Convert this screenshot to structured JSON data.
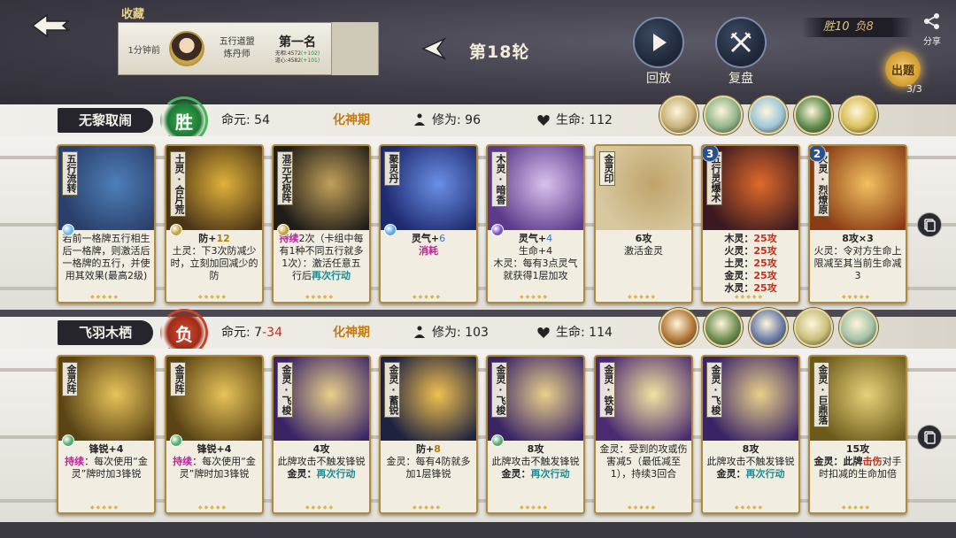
{
  "header": {
    "favorites_label": "收藏",
    "fav_card": {
      "time": "1分钟前",
      "title_line1": "五行道盟",
      "title_line2": "炼丹师",
      "rank": "第一名",
      "stat1_label": "无相:",
      "stat1_value": "4572",
      "stat1_delta": "(+102)",
      "stat2_label": "道心:",
      "stat2_value": "4582",
      "stat2_delta": "(+101)",
      "ladder_label": "天梯"
    },
    "round_label": "第18轮",
    "replay_label": "回放",
    "review_label": "复盘",
    "score_win": "胜10",
    "score_lose": "负8",
    "share_label": "分享",
    "quest_label": "出题",
    "quest_count": "3/3"
  },
  "player1": {
    "name": "无黎取闹",
    "result": "胜",
    "life_label": "命元:",
    "life_value": "54",
    "realm": "化神期",
    "cultivation_label": "修为:",
    "cultivation_value": "96",
    "hp_label": "生命:",
    "hp_value": "112",
    "avatar_colors": [
      "#c9b27a",
      "#8fb58a",
      "#9cc7d9",
      "#5f8d4e",
      "#d8c15a"
    ],
    "cards": [
      {
        "title": "五行流转",
        "orb": "#6cb8e8",
        "lines": [
          {
            "t": "若前一格牌五行相生后一格牌，则激活后一格牌的五行，并使用其效果(最高2级)"
          }
        ],
        "colors": [
          "#2a3f6b",
          "#4e7fb8"
        ]
      },
      {
        "title": "土灵·合片荒",
        "orb": "#c9a23a",
        "lines": [
          {
            "t": "防+",
            "c": "b"
          },
          {
            "t": "12",
            "c": "hl-gold",
            "inline": true
          },
          {
            "t": "土灵：下3次防减少时，立刻加回减少的防"
          }
        ],
        "colors": [
          "#4a3416",
          "#e0b23a"
        ]
      },
      {
        "title": "混元无极阵",
        "orb": "#c9a23a",
        "lines": [
          {
            "t": "持续",
            "c": "hl-magenta"
          },
          {
            "t": "2次（卡组中每有1种不同五行就多1次）：激活任意五行后",
            "inline": true
          },
          {
            "t": "再次行动",
            "c": "hl-teal",
            "inline": true
          }
        ],
        "colors": [
          "#201c18",
          "#c2a15a"
        ]
      },
      {
        "title": "聚灵丹",
        "orb": "#5da8e6",
        "lines": [
          {
            "t": "灵气+",
            "c": "b"
          },
          {
            "t": "6",
            "c": "hl-blue",
            "inline": true
          },
          {
            "t": "消耗",
            "c": "hl-magenta"
          }
        ],
        "colors": [
          "#1e2a6e",
          "#6b8fe6"
        ]
      },
      {
        "title": "木灵·暗香",
        "orb": "#7a4fd0",
        "lines": [
          {
            "t": "灵气+",
            "c": "b"
          },
          {
            "t": "4",
            "c": "hl-blue",
            "inline": true
          },
          {
            "t": "生命+4"
          },
          {
            "t": "木灵：每有3点灵气就获得1层加攻"
          }
        ],
        "colors": [
          "#5b3a8a",
          "#d9c2ee"
        ]
      },
      {
        "title": "金灵印",
        "orb": "",
        "lines": [
          {
            "t": "6攻",
            "c": "b"
          },
          {
            "t": "激活金灵"
          }
        ],
        "colors": [
          "#d8c8a0",
          "#bfa46a"
        ]
      },
      {
        "title": "五行灵爆术",
        "orb": "",
        "level": "3",
        "lines": [
          {
            "t": "木灵：",
            "c": "b"
          },
          {
            "t": "25攻",
            "c": "hl-red",
            "inline": true
          },
          {
            "t": "火灵：",
            "c": "b"
          },
          {
            "t": "25攻",
            "c": "hl-red",
            "inline": true
          },
          {
            "t": "土灵：",
            "c": "b"
          },
          {
            "t": "25攻",
            "c": "hl-red",
            "inline": true
          },
          {
            "t": "金灵：",
            "c": "b"
          },
          {
            "t": "25攻",
            "c": "hl-red",
            "inline": true
          },
          {
            "t": "水灵：",
            "c": "b"
          },
          {
            "t": "25攻",
            "c": "hl-red",
            "inline": true
          }
        ],
        "colors": [
          "#3a1a20",
          "#e06a2a"
        ]
      },
      {
        "title": "火灵·烈燎原",
        "orb": "",
        "level": "2",
        "lines": [
          {
            "t": "8攻×3",
            "c": "b"
          },
          {
            "t": "火灵：令对方生命上限减至其当前生命减3"
          }
        ],
        "colors": [
          "#8a3a14",
          "#f0c060"
        ]
      }
    ]
  },
  "player2": {
    "name": "飞羽木栖",
    "result": "负",
    "life_label": "命元:",
    "life_value_a": "7",
    "life_value_sep": "-",
    "life_value_b": "34",
    "realm": "化神期",
    "cultivation_label": "修为:",
    "cultivation_value": "103",
    "hp_label": "生命:",
    "hp_value": "114",
    "avatar_colors": [
      "#b57a3a",
      "#6f8f52",
      "#6c7fa8",
      "#c9c07a",
      "#a4c3a8"
    ],
    "cards": [
      {
        "title": "金灵阵",
        "orb": "#4fae6a",
        "lines": [
          {
            "t": "锋锐+4",
            "c": "b"
          },
          {
            "t": "持续",
            "c": "hl-magenta"
          },
          {
            "t": "：每次使用“金灵”牌时加3锋锐",
            "inline": true
          }
        ],
        "colors": [
          "#5a4416",
          "#e8c35a"
        ]
      },
      {
        "title": "金灵阵",
        "orb": "#4fae6a",
        "lines": [
          {
            "t": "锋锐+4",
            "c": "b"
          },
          {
            "t": "持续",
            "c": "hl-magenta"
          },
          {
            "t": "：每次使用“金灵”牌时加3锋锐",
            "inline": true
          }
        ],
        "colors": [
          "#5a4416",
          "#e8c35a"
        ]
      },
      {
        "title": "金灵·飞梭",
        "orb": "",
        "lines": [
          {
            "t": "4攻",
            "c": "b"
          },
          {
            "t": "此牌攻击不触发锋锐"
          },
          {
            "t": "金灵：",
            "c": "b"
          },
          {
            "t": "再次行动",
            "c": "hl-teal",
            "inline": true
          }
        ],
        "colors": [
          "#3a2466",
          "#e8d08a"
        ]
      },
      {
        "title": "金灵·蓄锐",
        "orb": "",
        "lines": [
          {
            "t": "防+",
            "c": "b"
          },
          {
            "t": "8",
            "c": "hl-gold",
            "inline": true
          },
          {
            "t": "金灵：每有4防就多加1层锋锐"
          }
        ],
        "colors": [
          "#1e2240",
          "#f0c050"
        ]
      },
      {
        "title": "金灵·飞梭",
        "orb": "#4fae6a",
        "lines": [
          {
            "t": "8攻",
            "c": "b"
          },
          {
            "t": "此牌攻击不触发锋锐"
          },
          {
            "t": "金灵：",
            "c": "b"
          },
          {
            "t": "再次行动",
            "c": "hl-teal",
            "inline": true
          }
        ],
        "colors": [
          "#3a2466",
          "#e8d08a"
        ]
      },
      {
        "title": "金灵·铁骨",
        "orb": "",
        "lines": [
          {
            "t": "金灵：受到的攻或伤害减5（最低减至1），持续3回合"
          }
        ],
        "colors": [
          "#4a2a70",
          "#f3e3a0"
        ]
      },
      {
        "title": "金灵·飞梭",
        "orb": "",
        "lines": [
          {
            "t": "8攻",
            "c": "b"
          },
          {
            "t": "此牌攻击不触发锋锐"
          },
          {
            "t": "金灵：",
            "c": "b"
          },
          {
            "t": "再次行动",
            "c": "hl-teal",
            "inline": true
          }
        ],
        "colors": [
          "#3a2466",
          "#e8d08a"
        ]
      },
      {
        "title": "金灵·巨鼎落",
        "orb": "",
        "lines": [
          {
            "t": "15攻",
            "c": "b"
          },
          {
            "t": "金灵：此牌",
            "c": "b"
          },
          {
            "t": "击伤",
            "c": "hl-red",
            "inline": true
          },
          {
            "t": "对手时扣减的生命加倍",
            "inline": true
          }
        ],
        "colors": [
          "#6b5a1a",
          "#e6d27a"
        ]
      }
    ]
  }
}
